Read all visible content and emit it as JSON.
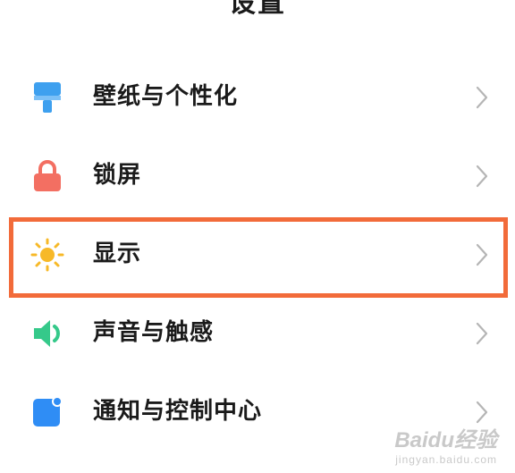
{
  "header": {
    "title": "设置"
  },
  "settings": {
    "items": [
      {
        "label": "壁纸与个性化",
        "icon": "brush-icon",
        "color": "#3ea0ef"
      },
      {
        "label": "锁屏",
        "icon": "lock-icon",
        "color": "#f36f62"
      },
      {
        "label": "显示",
        "icon": "sun-icon",
        "color": "#f7b928"
      },
      {
        "label": "声音与触感",
        "icon": "speaker-icon",
        "color": "#35c98a"
      },
      {
        "label": "通知与控制中心",
        "icon": "notification-icon",
        "color": "#2f8df5"
      }
    ]
  },
  "highlight": {
    "color": "#f26b3a"
  },
  "watermark": {
    "brand": "Baidu经验",
    "url": "jingyan.baidu.com"
  }
}
